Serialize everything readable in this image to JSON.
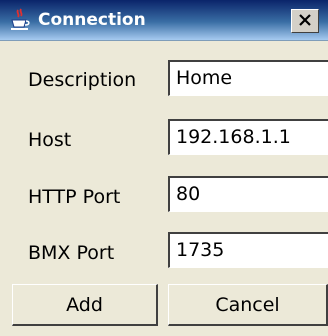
{
  "window": {
    "title": "Connection",
    "icons": {
      "app": "java-cup-icon",
      "close": "close-icon"
    }
  },
  "form": {
    "description_label": "Description",
    "description_value": "Home",
    "host_label": "Host",
    "host_value": "192.168.1.1",
    "http_port_label": "HTTP Port",
    "http_port_value": "80",
    "bmx_port_label": "BMX Port",
    "bmx_port_value": "1735"
  },
  "buttons": {
    "add_label": "Add",
    "cancel_label": "Cancel"
  },
  "colors": {
    "title_bar": "#0a246a",
    "dialog_bg": "#ece9d8"
  }
}
